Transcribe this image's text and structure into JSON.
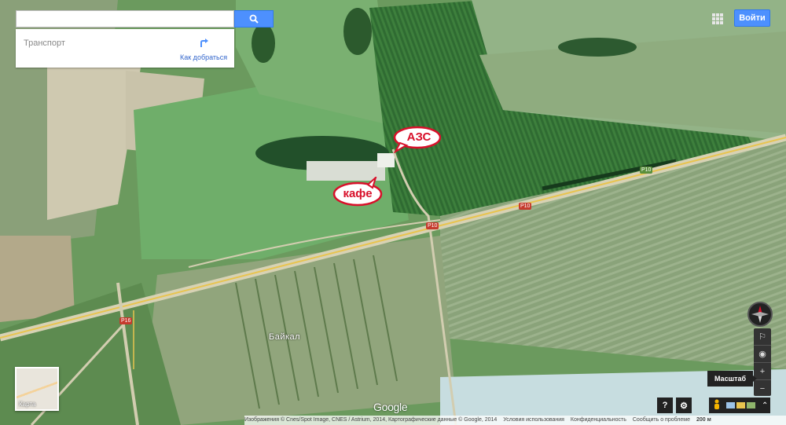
{
  "search": {
    "placeholder": "",
    "value": ""
  },
  "panel": {
    "transport_label": "Транспорт",
    "directions_label": "Как добраться"
  },
  "header": {
    "signin_label": "Войти"
  },
  "map": {
    "callouts": [
      {
        "label": "АЗС"
      },
      {
        "label": "кафе"
      }
    ],
    "village_label": "Байкал",
    "road_labels": [
      "P10",
      "P10",
      "P10",
      "P16"
    ]
  },
  "minimap": {
    "label": "Карта"
  },
  "logo": {
    "text": "Google"
  },
  "attribution": {
    "imagery": "Изображения © Cnes/Spot Image, CNES / Astrium, 2014, Картографические данные © Google, 2014",
    "terms": "Условия использования",
    "privacy": "Конфиденциальность",
    "report": "Сообщить о проблеме",
    "scale": "200 м"
  },
  "controls": {
    "zoom_tooltip": "Масштаб",
    "help_label": "?",
    "zoom_in": "+",
    "zoom_out": "−"
  },
  "colors": {
    "accent": "#4d90fe",
    "callout_red": "#d8102a",
    "road": "#e8c44f"
  }
}
